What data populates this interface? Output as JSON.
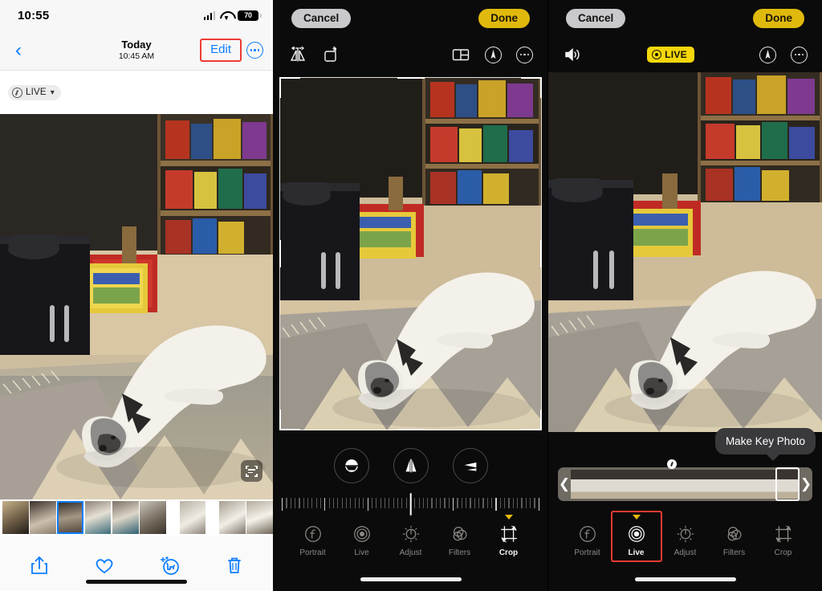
{
  "panel1": {
    "name": "photos-viewer",
    "status": {
      "time": "10:55",
      "battery": "70",
      "signal_icon": "cellular-bars-icon",
      "wifi_icon": "wifi-icon",
      "battery_icon": "battery-icon"
    },
    "nav": {
      "back_icon": "chevron-left-icon",
      "title": "Today",
      "subtitle": "10:45 AM",
      "edit_label": "Edit",
      "more_icon": "ellipsis-circle-icon",
      "highlight_color": "#ee3b33",
      "accent_color": "#0a7cff"
    },
    "live_chip": {
      "icon": "live-photo-icon",
      "label": "LIVE",
      "chevron": "chevron-down-icon"
    },
    "photo": {
      "livetext_icon": "live-text-icon",
      "alt": "White dog lying on patterned rug in living room"
    },
    "filmstrip": {
      "count": 9,
      "selected_index": 2
    },
    "actions": [
      {
        "name": "share-button",
        "icon": "share-icon",
        "label": "Share"
      },
      {
        "name": "favorite-button",
        "icon": "heart-icon",
        "label": "Favorite"
      },
      {
        "name": "visual-lookup-button",
        "icon": "dog-sparkle-icon",
        "label": "Look Up"
      },
      {
        "name": "delete-button",
        "icon": "trash-icon",
        "label": "Delete"
      }
    ]
  },
  "panel2": {
    "name": "photo-editor-crop",
    "top": {
      "cancel_label": "Cancel",
      "done_label": "Done",
      "done_color": "#e0b90d"
    },
    "tools_left": [
      {
        "name": "flip-button",
        "icon": "flip-horizontal-icon"
      },
      {
        "name": "rotate-button",
        "icon": "rotate-icon"
      }
    ],
    "tools_right": [
      {
        "name": "aspect-ratio-button",
        "icon": "aspect-ratio-icon"
      },
      {
        "name": "markup-button",
        "icon": "markup-pen-circle-icon"
      },
      {
        "name": "more-button",
        "icon": "ellipsis-circle-icon"
      }
    ],
    "geometry": [
      {
        "name": "straighten-button",
        "icon": "straighten-icon"
      },
      {
        "name": "vertical-perspective-button",
        "icon": "vertical-perspective-icon"
      },
      {
        "name": "horizontal-perspective-button",
        "icon": "horizontal-perspective-icon"
      }
    ],
    "ruler": {
      "value": 0,
      "unit": "degrees",
      "ticks": 61,
      "major_every": 10
    },
    "tabs": [
      {
        "name": "tab-portrait",
        "label": "Portrait",
        "icon": "portrait-f-icon",
        "active": false
      },
      {
        "name": "tab-live",
        "label": "Live",
        "icon": "live-photo-rings-icon",
        "active": false
      },
      {
        "name": "tab-adjust",
        "label": "Adjust",
        "icon": "adjust-dial-icon",
        "active": false
      },
      {
        "name": "tab-filters",
        "label": "Filters",
        "icon": "filters-circles-icon",
        "active": false
      },
      {
        "name": "tab-crop",
        "label": "Crop",
        "icon": "crop-rotate-icon",
        "active": true
      }
    ]
  },
  "panel3": {
    "name": "photo-editor-live",
    "top": {
      "cancel_label": "Cancel",
      "done_label": "Done",
      "done_color": "#e0b90d"
    },
    "mute_icon": "speaker-wave-icon",
    "live_badge": {
      "label": "LIVE",
      "icon": "live-photo-icon",
      "background": "#f5d70a"
    },
    "tools_right": [
      {
        "name": "markup-button",
        "icon": "markup-pen-circle-icon"
      },
      {
        "name": "more-button",
        "icon": "ellipsis-circle-icon"
      }
    ],
    "tooltip": {
      "label": "Make Key Photo"
    },
    "framestrip": {
      "frames": 11,
      "selected_index": 9,
      "left_arrow": "❮",
      "right_arrow": "❯",
      "key_dot_icon": "key-photo-dot-icon"
    },
    "tabs": [
      {
        "name": "tab-portrait",
        "label": "Portrait",
        "icon": "portrait-f-icon",
        "active": false
      },
      {
        "name": "tab-live",
        "label": "Live",
        "icon": "live-photo-rings-icon",
        "active": true,
        "highlight_color": "#ee3b33"
      },
      {
        "name": "tab-adjust",
        "label": "Adjust",
        "icon": "adjust-dial-icon",
        "active": false
      },
      {
        "name": "tab-filters",
        "label": "Filters",
        "icon": "filters-circles-icon",
        "active": false
      },
      {
        "name": "tab-crop",
        "label": "Crop",
        "icon": "crop-rotate-icon",
        "active": false
      }
    ]
  }
}
